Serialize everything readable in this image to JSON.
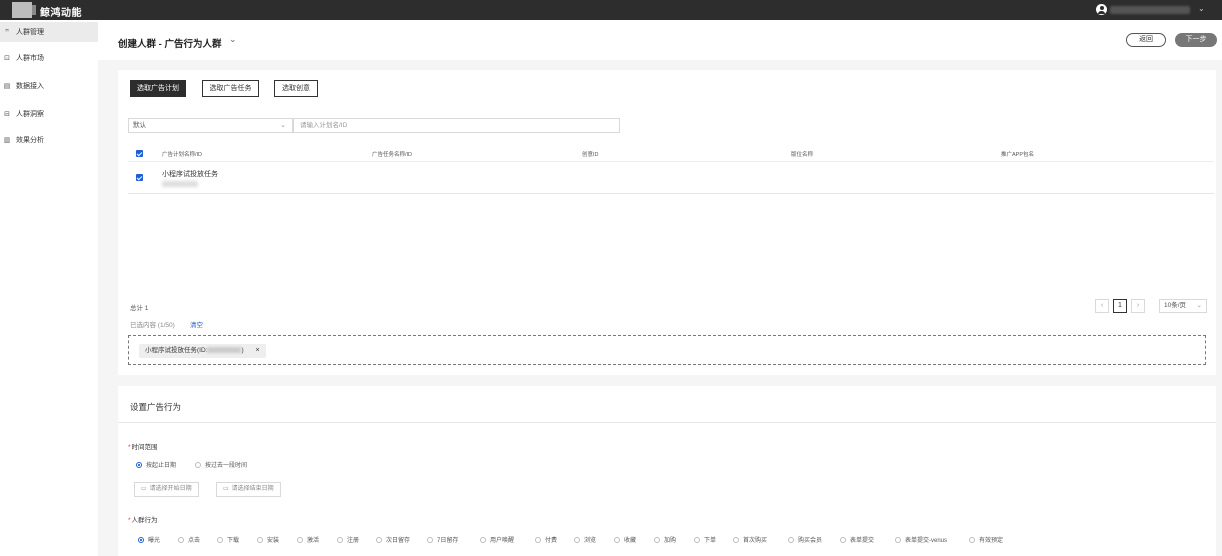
{
  "topbar": {
    "brand": "鲸鸿动能",
    "caret": "⌄"
  },
  "sidebar": {
    "items": [
      {
        "icon": "ꟸ",
        "label": "人群管理"
      },
      {
        "icon": "⊡",
        "label": "人群市场"
      },
      {
        "icon": "▤",
        "label": "数据接入"
      },
      {
        "icon": "⊟",
        "label": "人群洞察"
      },
      {
        "icon": "▥",
        "label": "效果分析"
      }
    ]
  },
  "header": {
    "title": "创建人群 - 广告行为人群",
    "title_caret": "⌄",
    "back_label": "返回",
    "next_label": "下一步"
  },
  "tabs": [
    "选取广告计划",
    "选取广告任务",
    "选取创意"
  ],
  "filter": {
    "select_value": "默认",
    "select_caret": "⌄",
    "search_placeholder": "请输入计划名/ID"
  },
  "table": {
    "columns": [
      "广告计划名称/ID",
      "广告任务名称/ID",
      "创意ID",
      "版位名称",
      "推广APP包名"
    ],
    "rows": [
      {
        "name": "小程序试投放任务"
      }
    ]
  },
  "footer": {
    "total": "总计 1",
    "selected": "已选内容 (1/50)",
    "clear": "清空",
    "pager_prev": "‹",
    "pager_current": "1",
    "pager_next": "›",
    "page_size": "10条/页",
    "page_size_caret": "⌄"
  },
  "tag": {
    "prefix": "小程序试投放任务(ID:",
    "suffix": ")",
    "close": "×"
  },
  "behavior": {
    "title": "设置广告行为",
    "time_label": "时间范围",
    "time_options": [
      "按起止日期",
      "按过去一段时间"
    ],
    "start_date": "请选择开始日期",
    "end_date": "请选择结束日期",
    "calendar_glyph": "▭",
    "action_label": "人群行为",
    "star": "*",
    "actions": [
      "曝光",
      "点击",
      "下载",
      "安装",
      "激活",
      "注册",
      "次日留存",
      "7日留存",
      "用户唤醒",
      "付费",
      "浏览",
      "收藏",
      "加购",
      "下单",
      "首次购买",
      "购买会员",
      "表单提交",
      "表单提交-venus",
      "有效预定"
    ]
  },
  "colors": {
    "accent": "#1b5fd9",
    "topbar": "#2d2d2d",
    "required": "#e33333"
  }
}
